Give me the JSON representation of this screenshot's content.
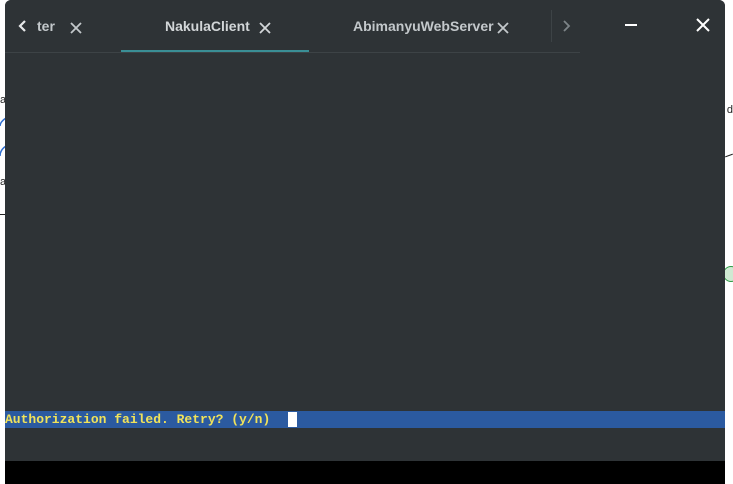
{
  "tabs": [
    {
      "label": "ter",
      "active": false
    },
    {
      "label": "NakulaClient",
      "active": true
    },
    {
      "label": "AbimanyuWebServer",
      "active": false
    }
  ],
  "icons": {
    "prev": "chevron-left-icon",
    "next": "chevron-right-icon",
    "close_tab": "close-icon",
    "minimize": "minimize-icon",
    "close_window": "close-icon"
  },
  "terminal": {
    "prompt": "Authorization failed. Retry? (y/n) "
  },
  "background": {
    "left_fragments": [
      "a",
      "a"
    ],
    "right_fragments": [
      "d"
    ]
  },
  "colors": {
    "window_bg": "#2e3336",
    "active_tab_underline": "#3a8f96",
    "prompt_bg": "#2b5aa0",
    "prompt_fg": "#f0e25a",
    "cursor": "#ffffff",
    "statusbar": "#000000"
  }
}
